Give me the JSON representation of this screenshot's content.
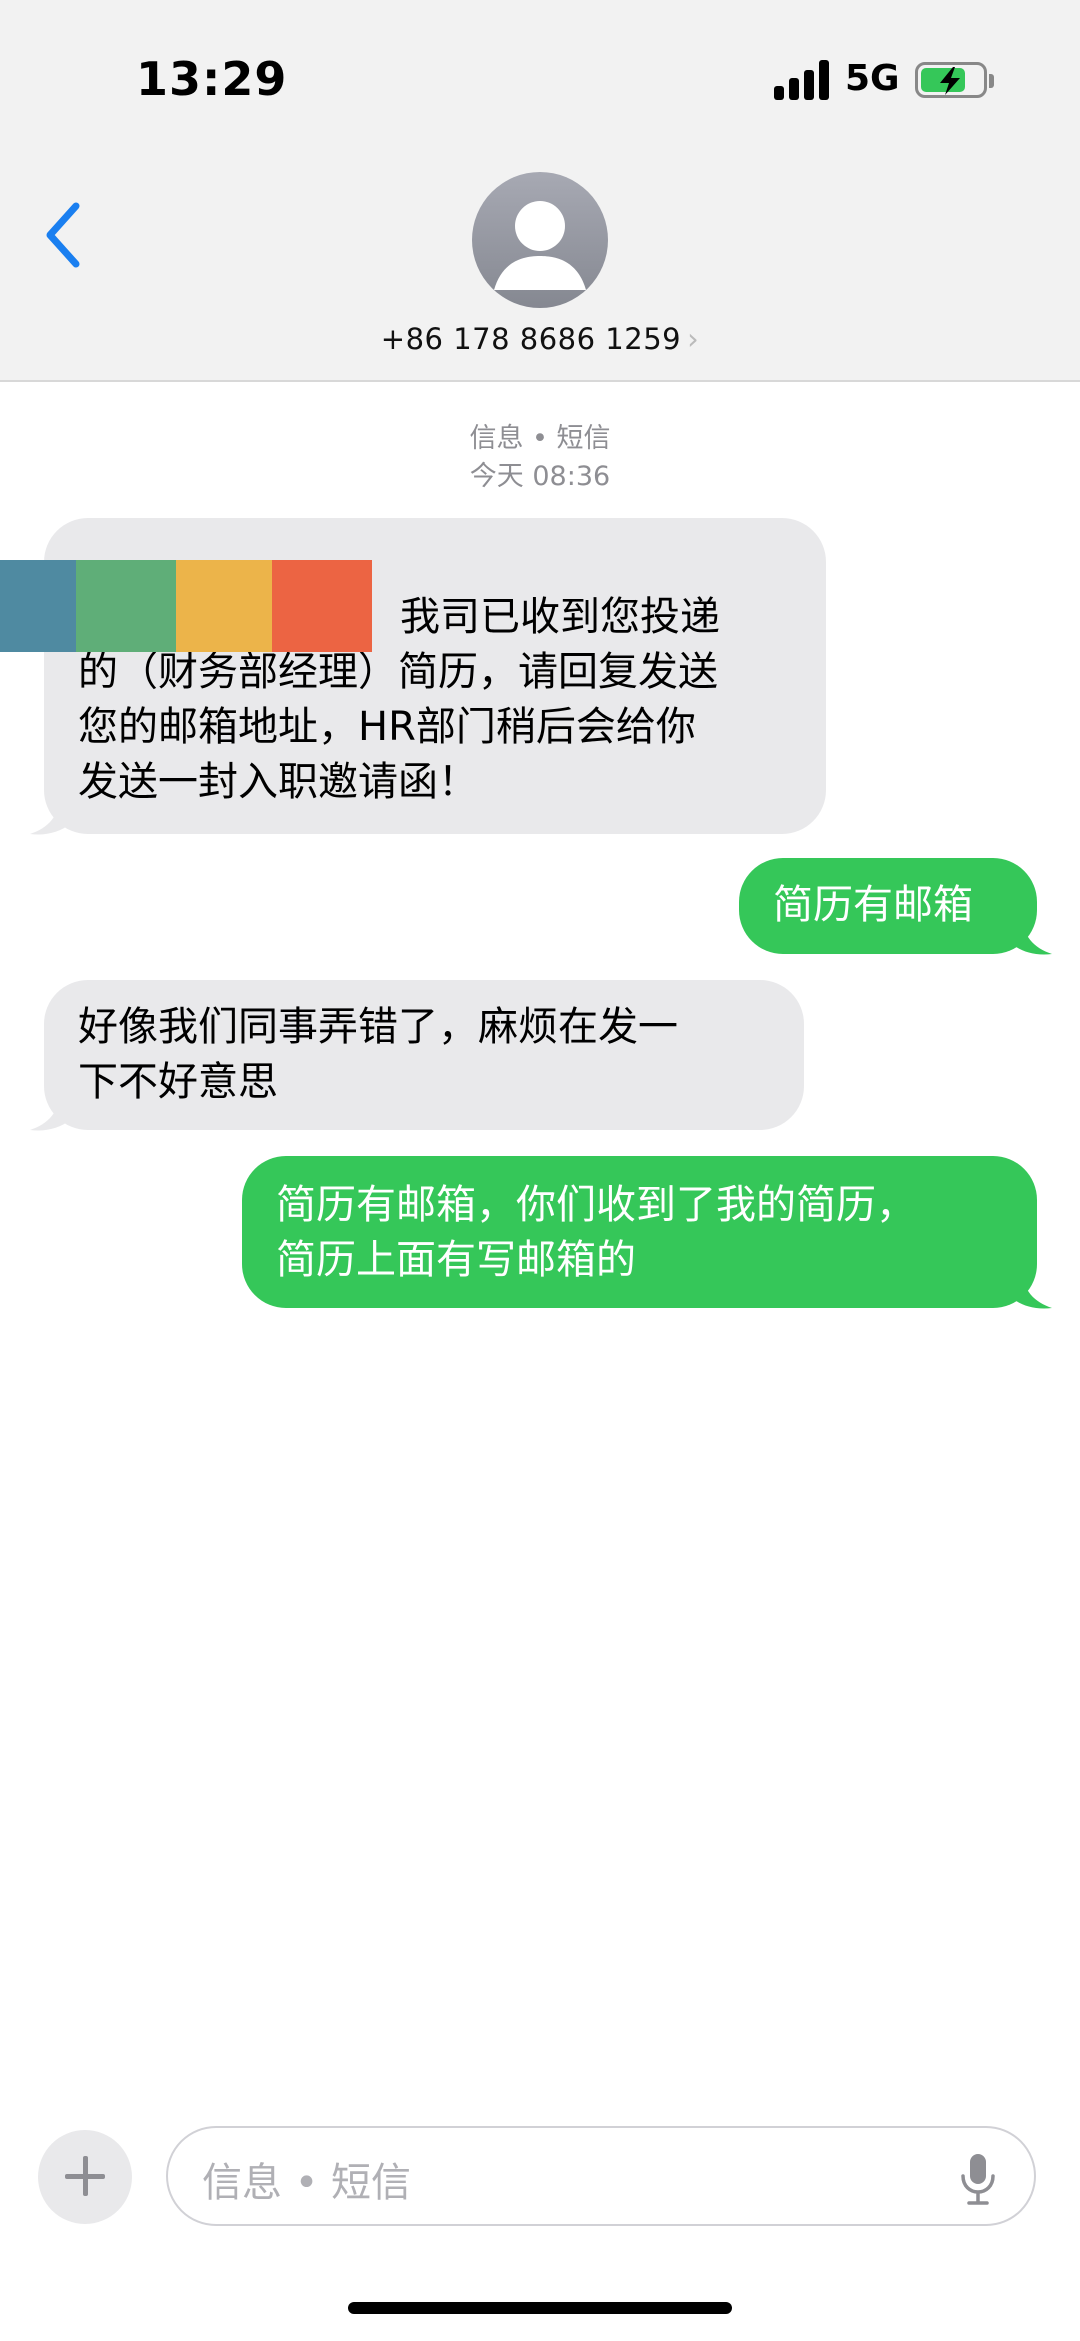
{
  "status_bar": {
    "time": "13:29",
    "network": "5G",
    "battery_state": "charging",
    "accent": "#35c759"
  },
  "header": {
    "contact_number": "+86 178 8686 1259",
    "chevron": "›",
    "back_icon": "chevron-left-icon",
    "avatar_icon": "person-avatar-icon"
  },
  "conversation": {
    "service_label": "信息 • 短信",
    "timestamp": "今天 08:36",
    "messages": [
      {
        "direction": "incoming",
        "lines": [
          "我司已收到您投递",
          "的（财务部经理）简历，请回复发送",
          "您的邮箱地址，HR部门稍后会给你",
          "发送一封入职邀请函！"
        ]
      },
      {
        "direction": "outgoing",
        "lines": [
          "简历有邮箱"
        ]
      },
      {
        "direction": "incoming",
        "lines": [
          "好像我们同事弄错了，麻烦在发一",
          "下不好意思"
        ]
      },
      {
        "direction": "outgoing",
        "lines": [
          "简历有邮箱，你们收到了我的简历，",
          "简历上面有写邮箱的"
        ]
      }
    ]
  },
  "composer": {
    "placeholder": "信息 • 短信",
    "plus_icon": "plus-icon",
    "mic_icon": "microphone-icon"
  },
  "colors": {
    "incoming_bubble": "#e9e9eb",
    "outgoing_bubble": "#35c759",
    "link_blue": "#1a7ff0"
  }
}
